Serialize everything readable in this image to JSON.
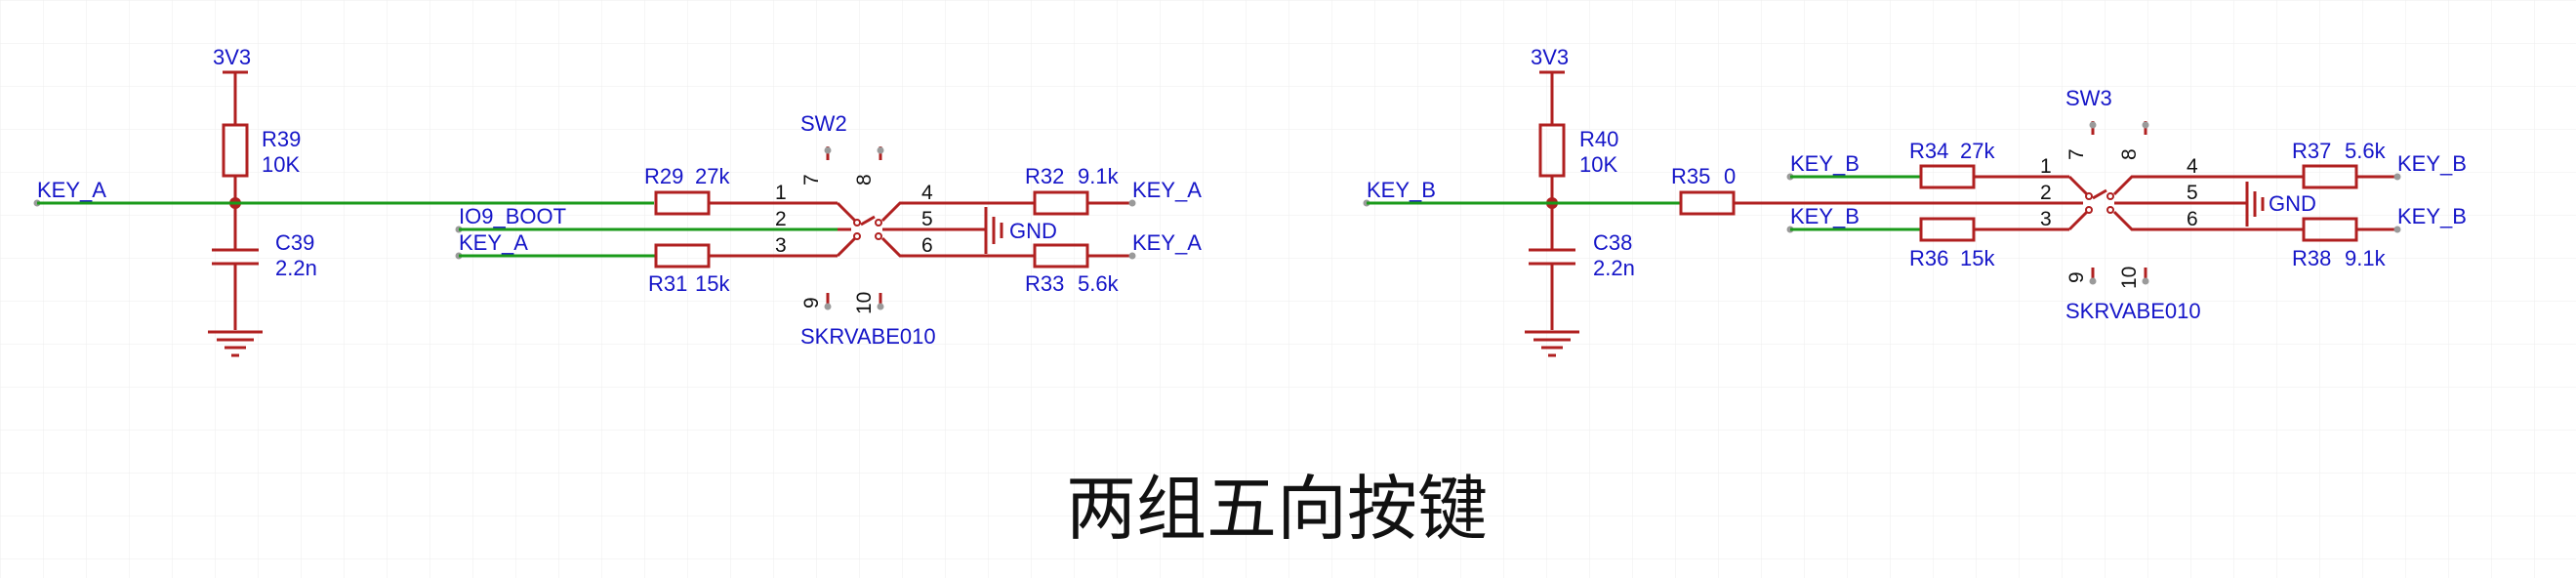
{
  "title": "两组五向按键",
  "colors": {
    "wire": "#1a9a1a",
    "component": "#b02020",
    "label": "#1515c8",
    "grid": "#ececec"
  },
  "left": {
    "power": "3V3",
    "net_in": "KEY_A",
    "r_pull": {
      "ref": "R39",
      "value": "10K"
    },
    "cap": {
      "ref": "C39",
      "value": "2.2n"
    },
    "sw": {
      "ref": "SW2",
      "part": "SKRVABE010"
    },
    "r_top": {
      "ref": "R29",
      "value": "27k"
    },
    "r_bot": {
      "ref": "R31",
      "value": "15k"
    },
    "r_out_top": {
      "ref": "R32",
      "value": "9.1k"
    },
    "r_out_bot": {
      "ref": "R33",
      "value": "5.6k"
    },
    "net_io9": "IO9_BOOT",
    "net_key2": "KEY_A",
    "net_out1": "KEY_A",
    "net_out2": "KEY_A",
    "gnd": "GND"
  },
  "right": {
    "power": "3V3",
    "net_in": "KEY_B",
    "r_pull": {
      "ref": "R40",
      "value": "10K"
    },
    "cap": {
      "ref": "C38",
      "value": "2.2n"
    },
    "r_series": {
      "ref": "R35",
      "value": "0"
    },
    "sw": {
      "ref": "SW3",
      "part": "SKRVABE010"
    },
    "r_top": {
      "ref": "R34",
      "value": "27k"
    },
    "r_bot": {
      "ref": "R36",
      "value": "15k"
    },
    "r_out_top": {
      "ref": "R37",
      "value": "5.6k"
    },
    "r_out_bot": {
      "ref": "R38",
      "value": "9.1k"
    },
    "net_b1": "KEY_B",
    "net_b2": "KEY_B",
    "net_out1": "KEY_B",
    "net_out2": "KEY_B",
    "gnd": "GND"
  },
  "pins": {
    "p1": "1",
    "p2": "2",
    "p3": "3",
    "p4": "4",
    "p5": "5",
    "p6": "6",
    "p7": "7",
    "p8": "8",
    "p9": "9",
    "p10": "10"
  }
}
